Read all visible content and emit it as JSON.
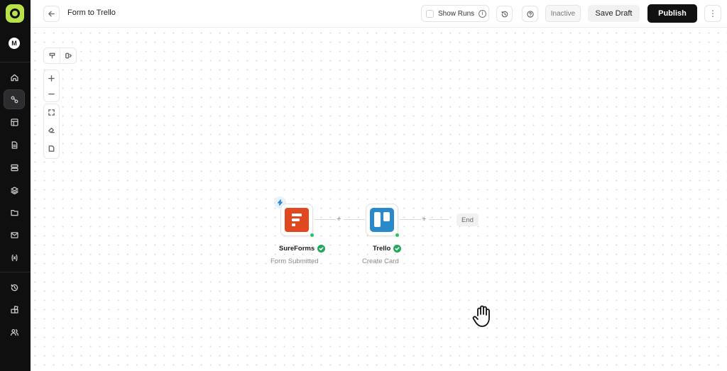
{
  "header": {
    "title": "Form to Trello",
    "show_runs_label": "Show Runs",
    "status_label": "Inactive",
    "save_draft_label": "Save Draft",
    "publish_label": "Publish"
  },
  "sidebar": {
    "avatar_initial": "M",
    "items": [
      {
        "icon": "home-icon",
        "active": false
      },
      {
        "icon": "workflow-icon",
        "active": true
      },
      {
        "icon": "table-icon",
        "active": false
      },
      {
        "icon": "document-icon",
        "active": false
      },
      {
        "icon": "database-icon",
        "active": false
      },
      {
        "icon": "layers-icon",
        "active": false
      },
      {
        "icon": "folder-icon",
        "active": false
      },
      {
        "icon": "mail-icon",
        "active": false
      },
      {
        "icon": "variables-icon",
        "active": false
      },
      {
        "icon": "history-icon",
        "active": false
      },
      {
        "icon": "apps-icon",
        "active": false
      },
      {
        "icon": "users-icon",
        "active": false
      }
    ]
  },
  "workflow": {
    "nodes": [
      {
        "app": "SureForms",
        "action": "Form Submitted",
        "trigger": true,
        "status": "success"
      },
      {
        "app": "Trello",
        "action": "Create Card",
        "trigger": false,
        "status": "success"
      }
    ],
    "end_label": "End",
    "add_step_symbol": "+"
  },
  "colors": {
    "brand_accent": "#b7e24a",
    "publish_bg": "#111111",
    "success": "#22a85a",
    "sureforms": "#e0481f",
    "trello": "#2a8ac9"
  }
}
